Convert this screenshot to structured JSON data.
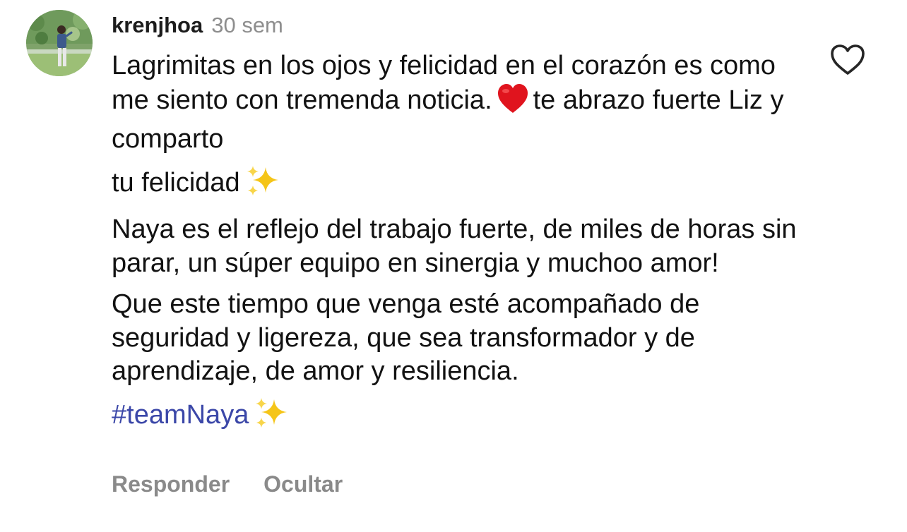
{
  "comment": {
    "username": "krenjhoa",
    "timestamp": "30 sem",
    "paragraphs": [
      {
        "before": "Lagrimitas en los ojos y felicidad en el corazón es como me siento con tremenda noticia.",
        "emoji": "red-heart-emoji",
        "after": "te abrazo fuerte Liz y comparto"
      },
      {
        "before": "tu felicidad",
        "emoji": "sparkles-emoji",
        "after": ""
      },
      {
        "before": "Naya es el reflejo del trabajo fuerte, de miles de horas sin parar, un súper equipo en sinergia y muchoo amor!",
        "emoji": "",
        "after": ""
      },
      {
        "before": "Que este tiempo que venga esté acompañado de seguridad y ligereza, que sea transformador y de aprendizaje, de amor y resiliencia.",
        "emoji": "",
        "after": ""
      }
    ],
    "hashtag": "#teamNaya",
    "hashtag_emoji": "sparkles-emoji",
    "actions": {
      "reply": "Responder",
      "hide": "Ocultar"
    },
    "like_icon": "heart-outline-icon"
  },
  "colors": {
    "username": "#1c1c1c",
    "timestamp": "#8e8e8e",
    "body_text": "#121212",
    "hashtag": "#3b47a8",
    "actions": "#8a8a8a",
    "heart_emoji": "#e0141e",
    "sparkles": "#f5c518"
  }
}
